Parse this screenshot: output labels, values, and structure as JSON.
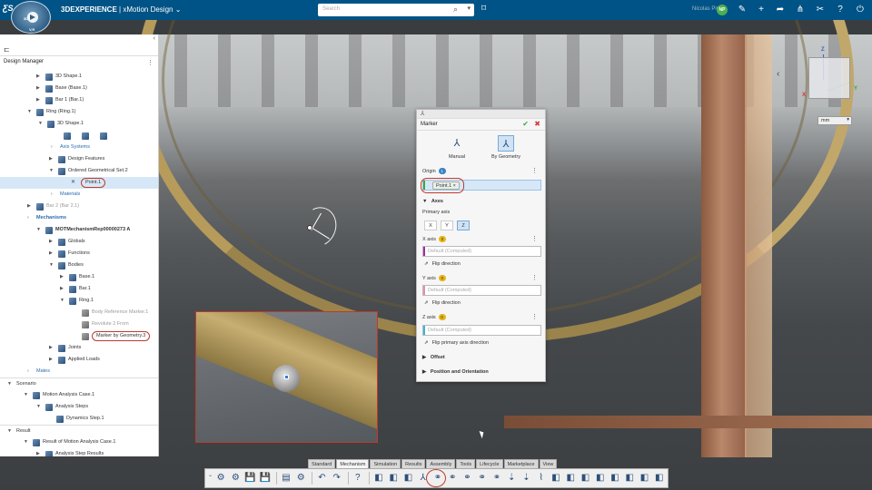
{
  "header": {
    "brand_prefix": "3DEXPERIENCE",
    "brand_sep": " | ",
    "app_name": "xMotion Design",
    "search_placeholder": "Search",
    "user_name": "Nicolas Pirolli",
    "user_initials": "NP",
    "compass_labels": [
      "3D",
      "V,R"
    ]
  },
  "left_panel": {
    "title": "Design Manager",
    "tree": [
      {
        "label": "3D Shape.1",
        "indent": 50,
        "icon": "part-icon",
        "toggle": "▶"
      },
      {
        "label": "Base (Base.1)",
        "indent": 50,
        "icon": "part-icon",
        "toggle": "▶"
      },
      {
        "label": "Bar 1 (Bar.1)",
        "indent": 50,
        "icon": "part-icon",
        "toggle": "▶"
      },
      {
        "label": "Ring (Ring.1)",
        "indent": 40,
        "icon": "part-icon",
        "toggle": "▼"
      },
      {
        "label": "3D Shape.1",
        "indent": 52,
        "icon": "part-icon",
        "toggle": "▼"
      },
      {
        "label": "",
        "indent": 66,
        "icon": "mini-icons",
        "toggle": ""
      },
      {
        "label": "Axis Systems",
        "indent": 66,
        "icon": "",
        "toggle": "›",
        "style": "blue"
      },
      {
        "label": "Design Features",
        "indent": 64,
        "icon": "part-icon",
        "toggle": "▶"
      },
      {
        "label": "Ordered Geometrical Set.2",
        "indent": 64,
        "icon": "part-icon",
        "toggle": "▼"
      },
      {
        "label": "Point.1",
        "indent": 78,
        "icon": "point-icon",
        "toggle": "",
        "selected": true,
        "highlight": true
      },
      {
        "label": "Materials",
        "indent": 66,
        "icon": "",
        "toggle": "›",
        "style": "blue"
      },
      {
        "label": "Bar 2 (Bar 2.1)",
        "indent": 40,
        "icon": "part-icon",
        "toggle": "▶",
        "style": "grey"
      },
      {
        "label": "Mechanisms",
        "indent": 40,
        "icon": "",
        "toggle": "›",
        "style": "blue",
        "bold": true
      },
      {
        "label": "MOTMechanismRep00000273 A",
        "indent": 50,
        "icon": "part-icon",
        "toggle": "▼",
        "bold": true
      },
      {
        "label": "Globals",
        "indent": 64,
        "icon": "part-icon",
        "toggle": "▶"
      },
      {
        "label": "Functions",
        "indent": 64,
        "icon": "part-icon",
        "toggle": "▶"
      },
      {
        "label": "Bodies",
        "indent": 64,
        "icon": "part-icon",
        "toggle": "▼"
      },
      {
        "label": "Base.1",
        "indent": 76,
        "icon": "part-icon",
        "toggle": "▶"
      },
      {
        "label": "Bar.1",
        "indent": 76,
        "icon": "part-icon",
        "toggle": "▶"
      },
      {
        "label": "Ring.1",
        "indent": 76,
        "icon": "part-icon",
        "toggle": "▼"
      },
      {
        "label": "Body Reference Marker.1",
        "indent": 90,
        "icon": "marker-icon",
        "toggle": "",
        "style": "grey"
      },
      {
        "label": "Revolute 2 From",
        "indent": 90,
        "icon": "marker-icon",
        "toggle": "",
        "style": "grey"
      },
      {
        "label": "Marker by Geometry.3",
        "indent": 90,
        "icon": "marker-icon",
        "toggle": "",
        "highlight": true
      },
      {
        "label": "Joints",
        "indent": 64,
        "icon": "part-icon",
        "toggle": "▶"
      },
      {
        "label": "Applied Loads",
        "indent": 64,
        "icon": "part-icon",
        "toggle": "▶"
      },
      {
        "label": "Mates",
        "indent": 40,
        "icon": "",
        "toggle": "›",
        "style": "blue"
      },
      {
        "label": "Scenario",
        "indent": 18,
        "icon": "",
        "toggle": "▼",
        "divider": true
      },
      {
        "label": "Motion Analysis Case.1",
        "indent": 36,
        "icon": "part-icon",
        "toggle": "▼"
      },
      {
        "label": "Analysis Steps",
        "indent": 50,
        "icon": "part-icon",
        "toggle": "▼"
      },
      {
        "label": "Dynamics Step.1",
        "indent": 62,
        "icon": "part-icon",
        "toggle": ""
      },
      {
        "label": "Result",
        "indent": 18,
        "icon": "",
        "toggle": "▼",
        "divider": true
      },
      {
        "label": "Result of Motion Analysis Case.1",
        "indent": 36,
        "icon": "part-icon",
        "toggle": "▼"
      },
      {
        "label": "Analysis Step Results",
        "indent": 50,
        "icon": "part-icon",
        "toggle": "▶"
      }
    ]
  },
  "marker_dialog": {
    "title": "Marker",
    "modes": [
      {
        "label": "Manual",
        "icon": "manual-marker-icon"
      },
      {
        "label": "By Geometry",
        "icon": "geometry-marker-icon",
        "active": true
      }
    ],
    "origin_label": "Origin",
    "origin_badge": "1",
    "origin_value": "Point.1",
    "axes_label": "Axes",
    "primary_axis_label": "Primary axis",
    "primary_axis_options": [
      "X",
      "Y",
      "Z"
    ],
    "primary_axis_selected": "Z",
    "x_axis_label": "X axis",
    "x_axis_badge": "0",
    "x_axis_placeholder": "Default (Computed)",
    "y_axis_label": "Y axis",
    "y_axis_badge": "0",
    "y_axis_placeholder": "Default (Computed)",
    "z_axis_label": "Z axis",
    "z_axis_badge": "0",
    "z_axis_placeholder": "Default (Computed)",
    "flip_direction": "Flip direction",
    "flip_primary": "Flip primary axis direction",
    "offset_label": "Offset",
    "position_label": "Position and Orientation",
    "colors": {
      "x": "#a12b9e",
      "y": "#e28fb4",
      "z": "#36b7d8"
    }
  },
  "viewport": {
    "units": "mm",
    "axis_labels": {
      "x": "X",
      "y": "Y",
      "z": "Z"
    }
  },
  "toolbar": {
    "tabs": [
      "Standard",
      "Mechanism",
      "Simulation",
      "Results",
      "Assembly",
      "Tools",
      "Lifecycle",
      "Marketplace",
      "View"
    ],
    "active_tab": "Mechanism",
    "icons": [
      "gear-icon",
      "gear-icon",
      "save-icon",
      "save-icon",
      "sep",
      "layers-icon",
      "gear-icon",
      "sep",
      "undo-icon",
      "redo-icon",
      "sep",
      "help-icon",
      "sep",
      "part-icon",
      "part-icon",
      "part-icon",
      "marker-icon",
      "joint-icon",
      "joint-icon",
      "joint-icon",
      "joint-icon",
      "joint-icon",
      "load-icon",
      "load-icon",
      "spring-icon",
      "part-icon",
      "part-icon",
      "part-icon",
      "part-icon",
      "part-icon",
      "part-icon",
      "part-icon",
      "part-icon"
    ]
  }
}
